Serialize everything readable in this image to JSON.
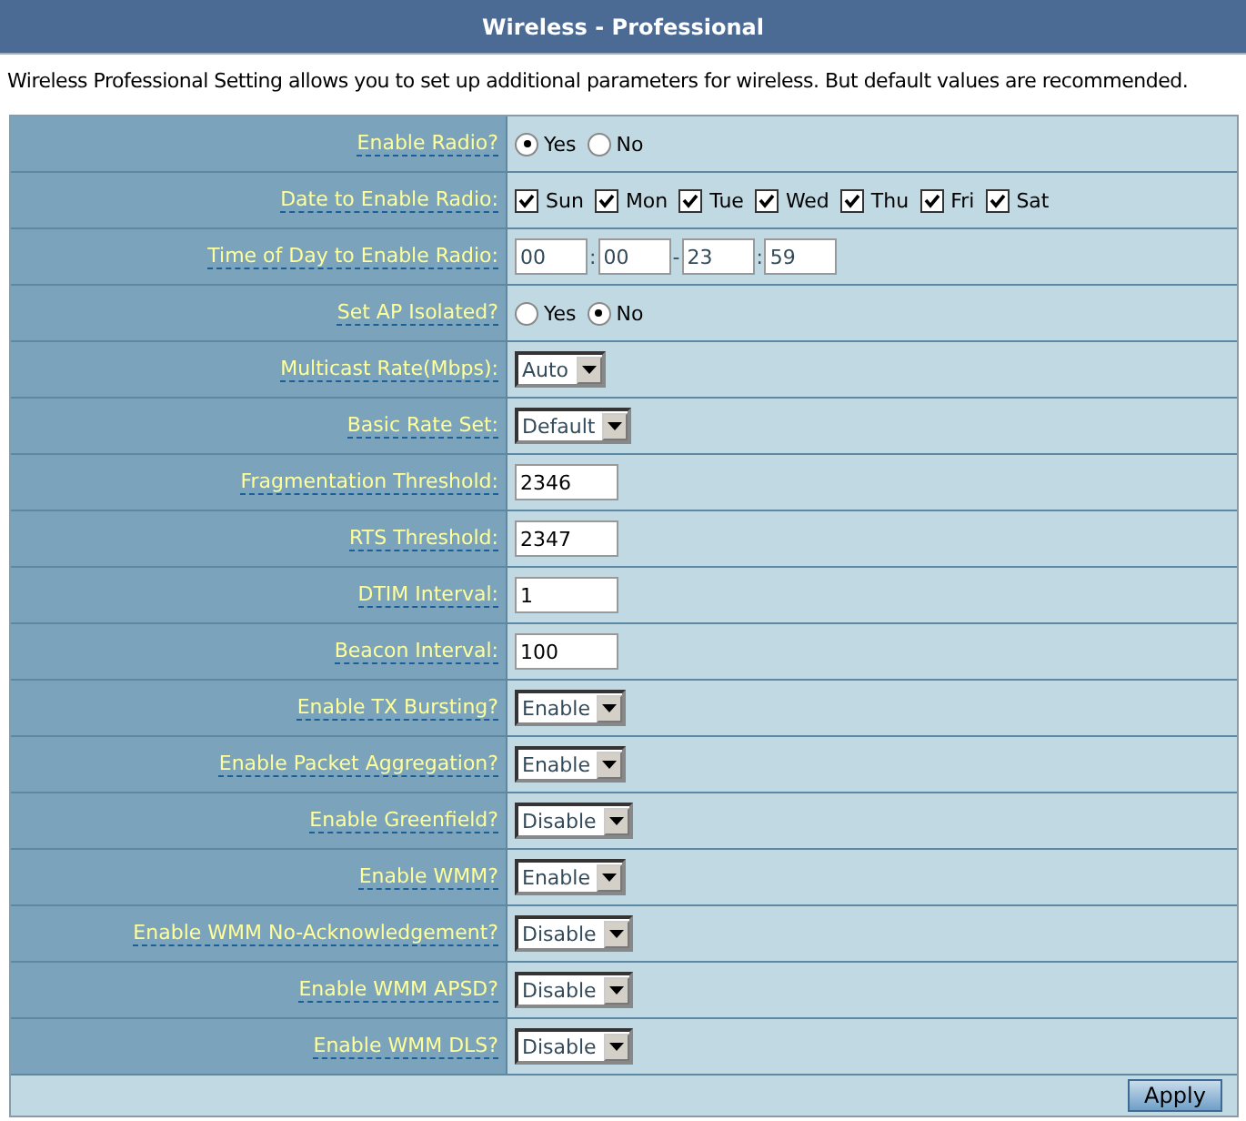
{
  "header": {
    "title": "Wireless - Professional"
  },
  "description": "Wireless Professional Setting allows you to set up additional parameters for wireless. But default values are recommended.",
  "rows": [
    {
      "kind": "radio",
      "label": "Enable Radio?",
      "options": [
        {
          "label": "Yes",
          "selected": true
        },
        {
          "label": "No",
          "selected": false
        }
      ]
    },
    {
      "kind": "days",
      "label": "Date to Enable Radio:",
      "days": [
        {
          "label": "Sun",
          "checked": true
        },
        {
          "label": "Mon",
          "checked": true
        },
        {
          "label": "Tue",
          "checked": true
        },
        {
          "label": "Wed",
          "checked": true
        },
        {
          "label": "Thu",
          "checked": true
        },
        {
          "label": "Fri",
          "checked": true
        },
        {
          "label": "Sat",
          "checked": true
        }
      ]
    },
    {
      "kind": "time",
      "label": "Time of Day to Enable Radio:",
      "start_hour": "00",
      "start_minute": "00",
      "end_hour": "23",
      "end_minute": "59",
      "separator": ":",
      "range_separator": "-"
    },
    {
      "kind": "radio",
      "label": "Set AP Isolated?",
      "options": [
        {
          "label": "Yes",
          "selected": false
        },
        {
          "label": "No",
          "selected": true
        }
      ]
    },
    {
      "kind": "select",
      "label": "Multicast Rate(Mbps):",
      "value": "Auto"
    },
    {
      "kind": "select",
      "label": "Basic Rate Set:",
      "value": "Default"
    },
    {
      "kind": "text",
      "label": "Fragmentation Threshold:",
      "value": "2346"
    },
    {
      "kind": "text",
      "label": "RTS Threshold:",
      "value": "2347"
    },
    {
      "kind": "text",
      "label": "DTIM Interval:",
      "value": "1"
    },
    {
      "kind": "text",
      "label": "Beacon Interval:",
      "value": "100"
    },
    {
      "kind": "select",
      "label": "Enable TX Bursting?",
      "value": "Enable"
    },
    {
      "kind": "select",
      "label": "Enable Packet Aggregation?",
      "value": "Enable"
    },
    {
      "kind": "select",
      "label": "Enable Greenfield?",
      "value": "Disable"
    },
    {
      "kind": "select",
      "label": "Enable WMM?",
      "value": "Enable"
    },
    {
      "kind": "select",
      "label": "Enable WMM No-Acknowledgement?",
      "value": "Disable"
    },
    {
      "kind": "select",
      "label": "Enable WMM APSD?",
      "value": "Disable"
    },
    {
      "kind": "select",
      "label": "Enable WMM DLS?",
      "value": "Disable"
    }
  ],
  "apply_button": "Apply"
}
